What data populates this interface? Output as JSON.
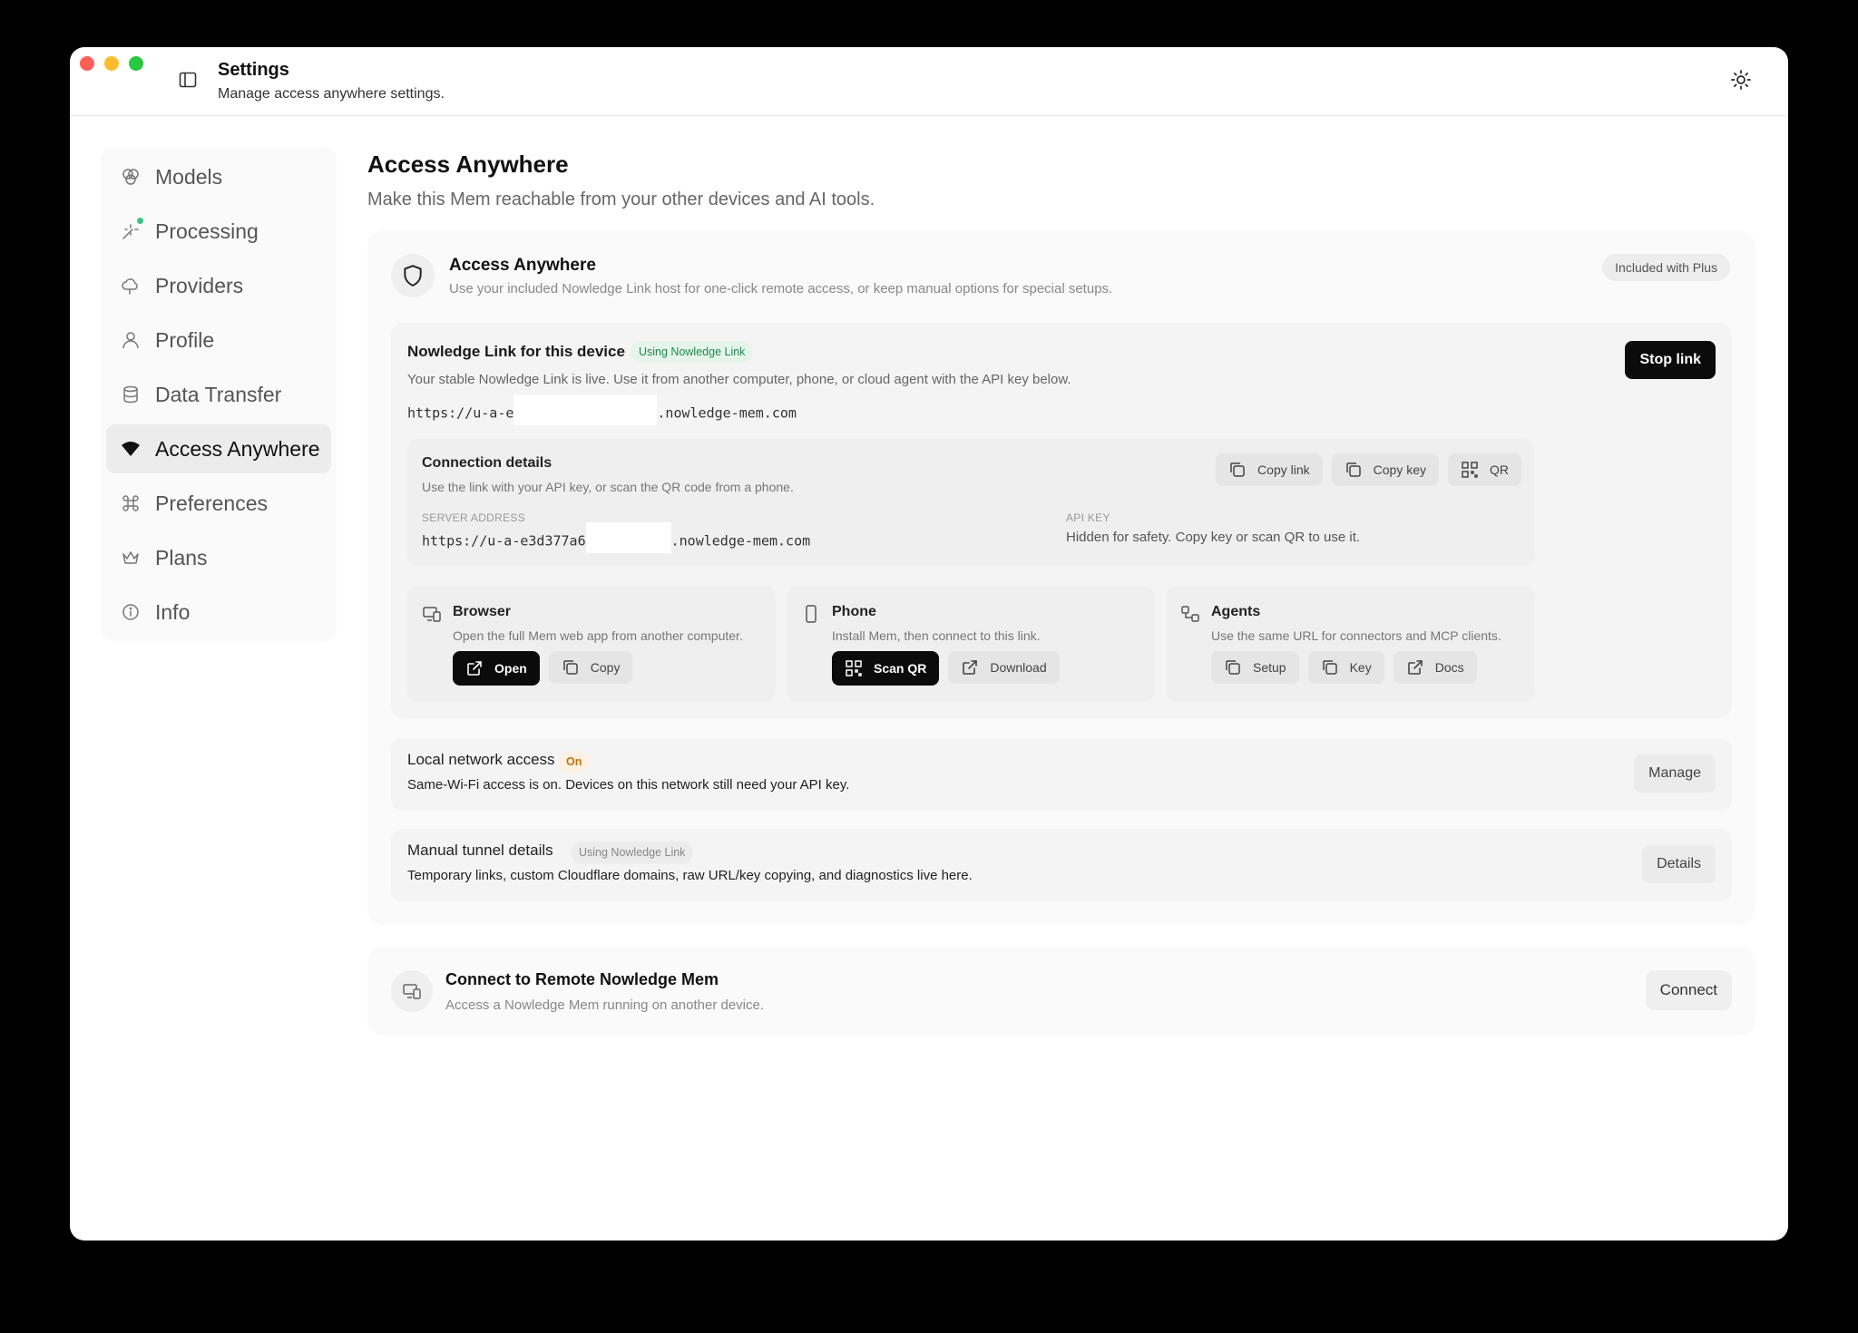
{
  "window": {
    "title": "Settings",
    "subtitle": "Manage access anywhere settings."
  },
  "sidebar": {
    "items": [
      {
        "label": "Models",
        "icon": "brain-icon"
      },
      {
        "label": "Processing",
        "icon": "sparkle-icon"
      },
      {
        "label": "Providers",
        "icon": "cloud-icon"
      },
      {
        "label": "Profile",
        "icon": "user-icon"
      },
      {
        "label": "Data Transfer",
        "icon": "database-icon"
      },
      {
        "label": "Access Anywhere",
        "icon": "wifi-icon",
        "active": true
      },
      {
        "label": "Preferences",
        "icon": "command-icon"
      },
      {
        "label": "Plans",
        "icon": "crown-icon"
      },
      {
        "label": "Info",
        "icon": "info-icon"
      }
    ]
  },
  "main": {
    "title": "Access Anywhere",
    "subtitle": "Make this Mem reachable from your other devices and AI tools."
  },
  "panel": {
    "title": "Access Anywhere",
    "desc": "Use your included Nowledge Link host for one-click remote access, or keep manual options for special setups.",
    "badge": "Included with Plus"
  },
  "link": {
    "title": "Nowledge Link for this device",
    "badge": "Using Nowledge Link",
    "desc": "Your stable Nowledge Link is live. Use it from another computer, phone, or cloud agent with the API key below.",
    "url_prefix": "https://u-a-e",
    "url_suffix": ".nowledge-mem.com",
    "stop_label": "Stop link"
  },
  "connection": {
    "title": "Connection details",
    "desc": "Use the link with your API key, or scan the QR code from a phone.",
    "copy_link": "Copy link",
    "copy_key": "Copy key",
    "qr": "QR",
    "server_label": "SERVER ADDRESS",
    "server_prefix": "https://u-a-e3d377a6",
    "server_suffix": ".nowledge-mem.com",
    "apikey_label": "API KEY",
    "apikey_value": "Hidden for safety. Copy key or scan QR to use it."
  },
  "devices": {
    "browser": {
      "title": "Browser",
      "desc": "Open the full Mem web app from another computer.",
      "primary": "Open",
      "secondary": "Copy"
    },
    "phone": {
      "title": "Phone",
      "desc": "Install Mem, then connect to this link.",
      "primary": "Scan QR",
      "secondary": "Download"
    },
    "agents": {
      "title": "Agents",
      "desc": "Use the same URL for connectors and MCP clients.",
      "b1": "Setup",
      "b2": "Key",
      "b3": "Docs"
    }
  },
  "local": {
    "title": "Local network access",
    "badge": "On",
    "desc": "Same-Wi-Fi access is on. Devices on this network still need your API key.",
    "button": "Manage"
  },
  "tunnel": {
    "title": "Manual tunnel details",
    "badge": "Using Nowledge Link",
    "desc": "Temporary links, custom Cloudflare domains, raw URL/key copying, and diagnostics live here.",
    "button": "Details"
  },
  "remote": {
    "title": "Connect to Remote Nowledge Mem",
    "desc": "Access a Nowledge Mem running on another device.",
    "button": "Connect"
  },
  "colors": {
    "accent": "#0b0b0b",
    "green_badge": "#1e8a4a",
    "orange_badge": "#c6700b"
  }
}
